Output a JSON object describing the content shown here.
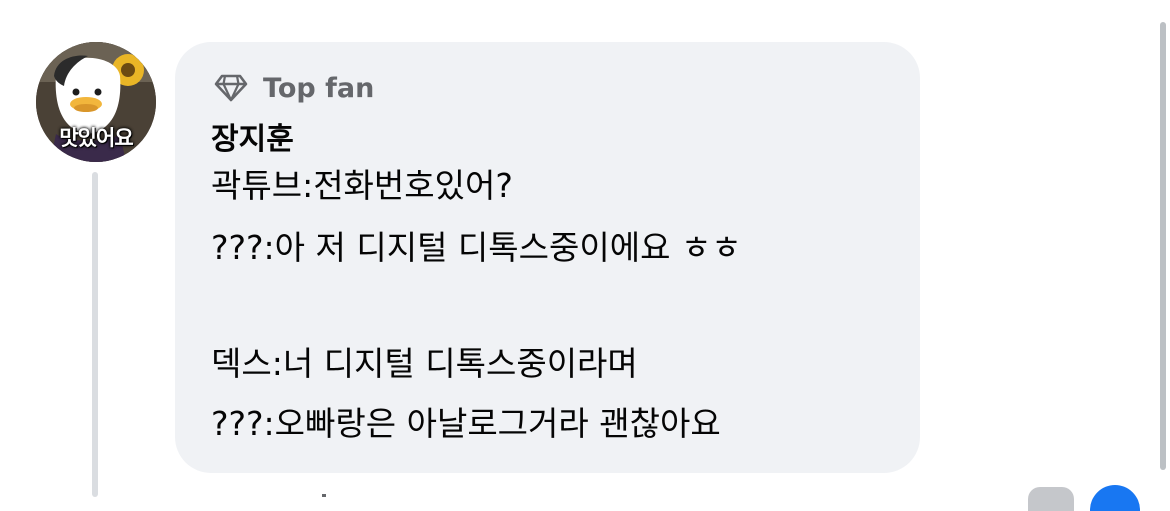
{
  "comment": {
    "badge": {
      "icon": "diamond-icon",
      "label": "Top fan"
    },
    "author": "장지훈",
    "avatar": {
      "caption": "맛있어요"
    },
    "lines": [
      "곽튜브:전화번호있어?",
      "???:아 저 디지털 디톡스중이에요 ㅎㅎ",
      "",
      "덱스:너 디지털 디톡스중이라며",
      "???:오빠랑은 아날로그거라 괜찮아요"
    ]
  },
  "colors": {
    "bubble_background": "#f0f2f5",
    "badge_text": "#65676b",
    "text": "#050505",
    "thread_line": "#dadde1",
    "like_blue": "#1877f2"
  }
}
